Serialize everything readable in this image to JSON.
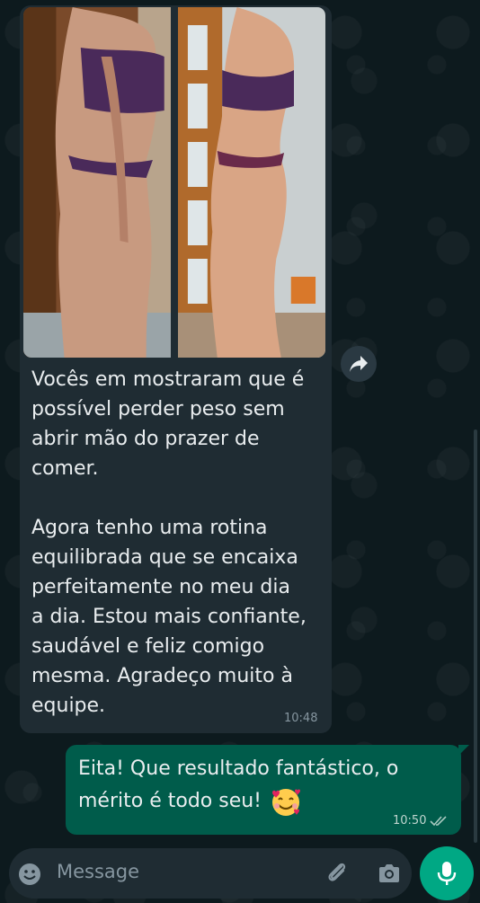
{
  "incoming_message": {
    "text": "Vocês em mostraram que é\npossível perder peso sem\nabrir mão do prazer de\ncomer.\n\nAgora tenho uma rotina\nequilibrada que se encaixa\nperfeitamente no meu dia\na dia. Estou mais confiante,\nsaudável e feliz comigo\nmesma. Agradeço muito à\nequipe.",
    "time": "10:48",
    "image_alt": [
      "before photo",
      "after photo"
    ]
  },
  "outgoing_message": {
    "text": "Eita! Que resultado fantástico, o mérito é todo seu!",
    "emoji": "smiling-face-with-hearts",
    "time": "10:50",
    "status": "read"
  },
  "composer": {
    "placeholder": "Message"
  },
  "colors": {
    "incoming_bubble": "#1f2c33",
    "outgoing_bubble": "#005c4b",
    "accent": "#00a884"
  }
}
